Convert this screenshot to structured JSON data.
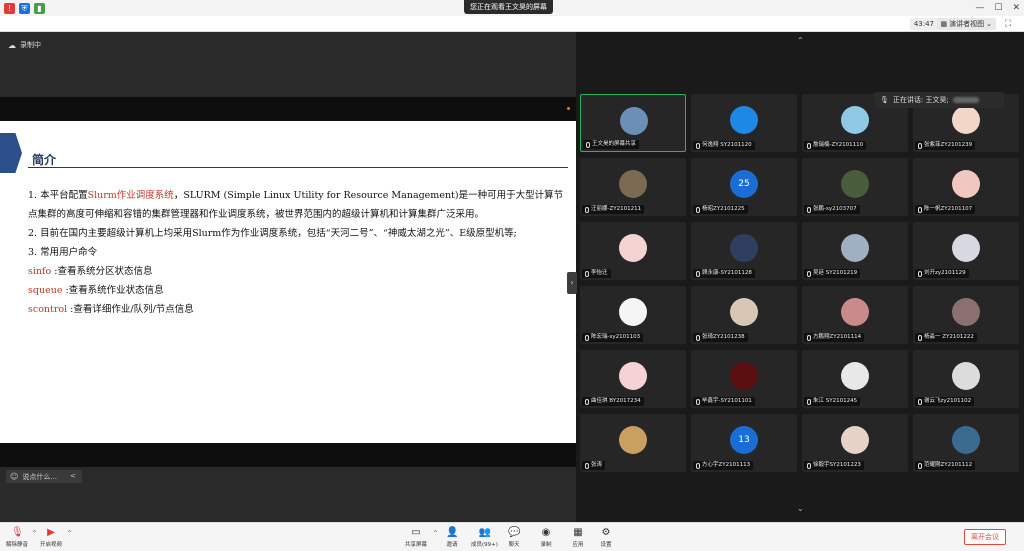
{
  "titlebar": {
    "viewing_banner": "您正在观看王文昊的屏幕",
    "minimize": "—",
    "maximize": "☐",
    "close": "✕"
  },
  "subbar": {
    "timer": "43:47",
    "view_label": "演讲者视图",
    "view_chevron": "⌄"
  },
  "share": {
    "recording_label": "录制中",
    "chat_placeholder": "说点什么...",
    "chat_arrow": "<",
    "collapse_arrow": "›"
  },
  "slide": {
    "title": "简介",
    "line1_a": "1.  本平台配置",
    "line1_red": "Slurm作业调度系统",
    "line1_b": "，SLURM (Simple Linux Utility for Resource Management)是一种可用于大型计算节点集群的高度可伸缩和容错的集群管理器和作业调度系统，被世界范围内的超级计算机和计算集群广泛采用。",
    "line2": "2.  目前在国内主要超级计算机上均采用Slurm作为作业调度系统，包括“天河二号”、“神威太湖之光”、E级原型机等;",
    "line3": "3.  常用用户命令",
    "cmd1_name": "sinfo",
    "cmd1_desc": " :查看系统分区状态信息",
    "cmd2_name": "squeue",
    "cmd2_desc": " :查看系统作业状态信息",
    "cmd3_name": "scontrol",
    "cmd3_desc": " :查看详细作业/队列/节点信息"
  },
  "gallery": {
    "speaking_label": "正在讲话: 王文昊;",
    "up_arrow": "⌃",
    "down_arrow": "⌄",
    "tiles": [
      {
        "name": "王文昊的屏幕共享",
        "color": "#6b8fb5"
      },
      {
        "name": "何逸翔 SY2101120",
        "color": "#1e88e5"
      },
      {
        "name": "詹瑞楠-ZY2101110",
        "color": "#8ecae6"
      },
      {
        "name": "张紫菲ZY2101239",
        "color": "#f2d7c9"
      },
      {
        "name": "汪丽娜-ZY2101211",
        "color": "#7a6a52"
      },
      {
        "name": "杨昭ZY2101225",
        "number": "25"
      },
      {
        "name": "张鹏-sy2103707",
        "color": "#4a5d3a"
      },
      {
        "name": "陈一帆ZY2101107",
        "color": "#f0c8c0"
      },
      {
        "name": "李怡迁",
        "color": "#f4d3d3"
      },
      {
        "name": "顾永康-SY2101128",
        "color": "#2f3f5f"
      },
      {
        "name": "吴廷 SY2101219",
        "color": "#9fb0c2"
      },
      {
        "name": "刘开zy2101129",
        "color": "#d8d8e0"
      },
      {
        "name": "陈宏瑞-sy2101103",
        "color": "#f5f5f5"
      },
      {
        "name": "张琦ZY2101238",
        "color": "#d9c7b5"
      },
      {
        "name": "方鹏翔ZY2101114",
        "color": "#c98a8a"
      },
      {
        "name": "杨淼一 ZY2101222",
        "color": "#8a7070"
      },
      {
        "name": "曲佳琪 BY2017234",
        "color": "#f6d2d6"
      },
      {
        "name": "毕鑫宇-SY2101101",
        "color": "#5a1010"
      },
      {
        "name": "朱江 SY2101245",
        "color": "#e8e8e8"
      },
      {
        "name": "谢云飞zy2101102",
        "color": "#dcdcdc"
      },
      {
        "name": "张涛",
        "color": "#c9a060"
      },
      {
        "name": "方心宇ZY2101113",
        "number": "13"
      },
      {
        "name": "徐毅宇SY2101223",
        "color": "#e6d2c6"
      },
      {
        "name": "范耀刚ZY2101112",
        "color": "#3b6a8f"
      }
    ]
  },
  "toolbar": {
    "mute": "解除静音",
    "video": "开启视频",
    "share": "共享屏幕",
    "invite": "邀请",
    "members": "成员(99+)",
    "chat": "聊天",
    "record": "录制",
    "apps": "应用",
    "settings": "设置",
    "leave": "离开会议",
    "caret": "^"
  },
  "colors": {
    "accent_green": "#2fb25f",
    "leave_red": "#e64a3b",
    "slide_red": "#c0392b",
    "slide_blue": "#1f3a66",
    "number_avatar": "#1a6dd6"
  }
}
